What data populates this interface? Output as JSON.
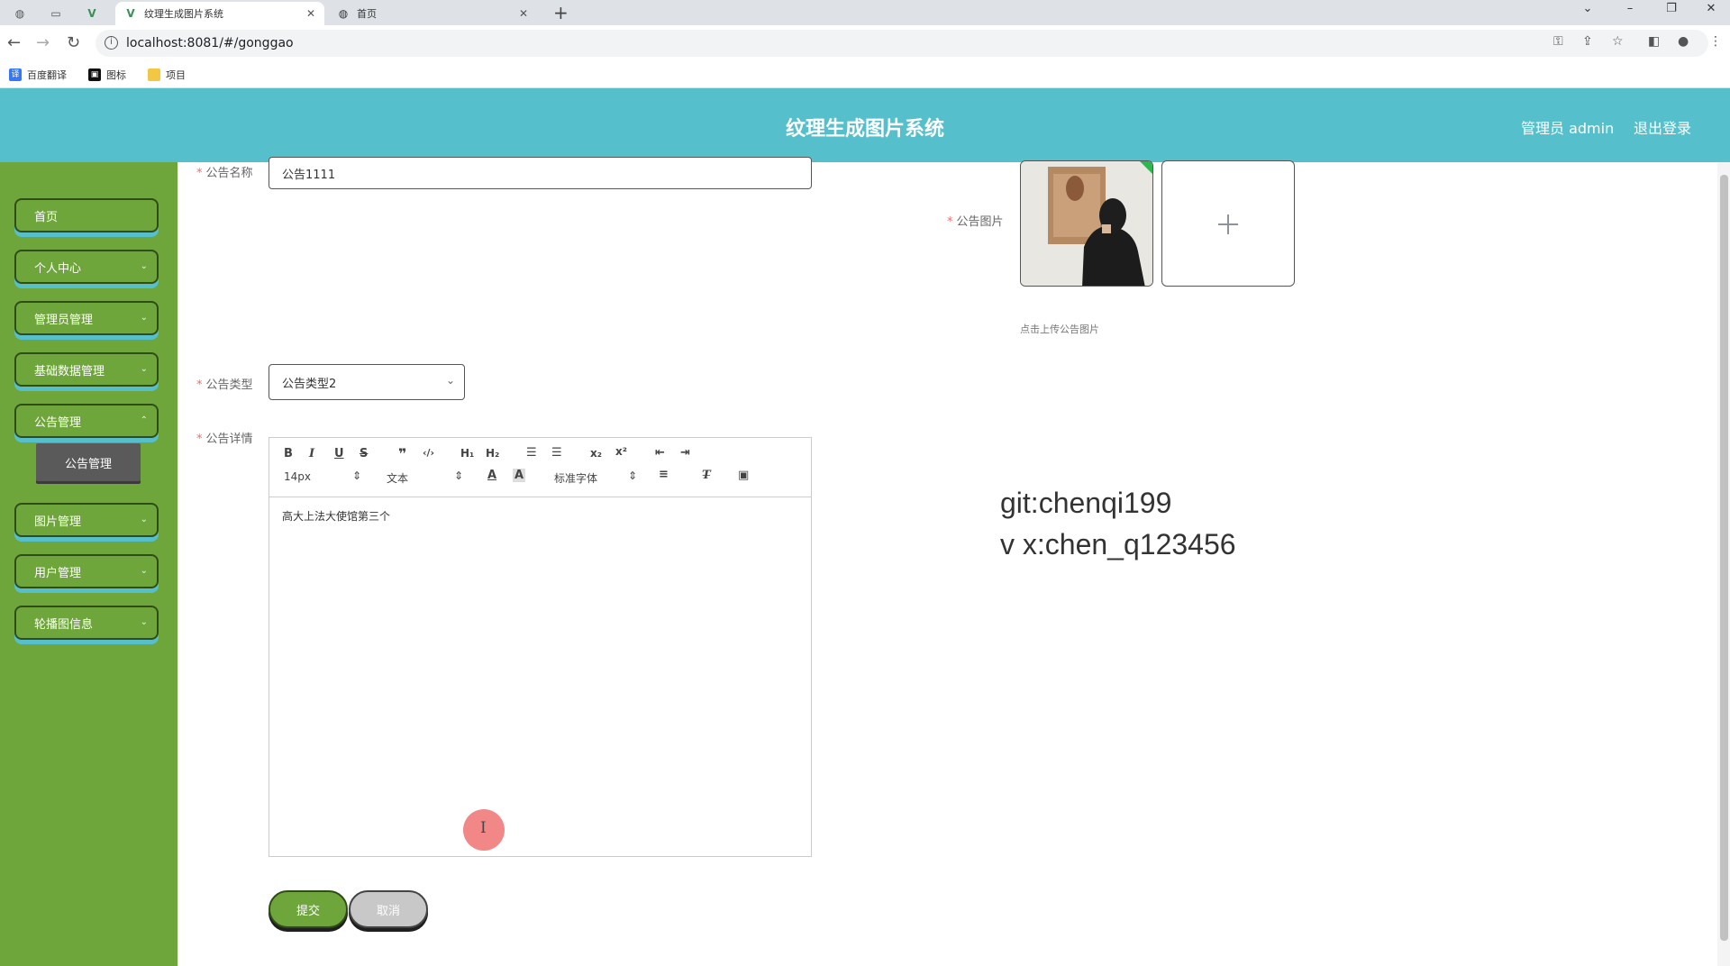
{
  "browser": {
    "tabs": [
      {
        "title": "纹理生成图片系统",
        "active": true
      },
      {
        "title": "首页",
        "active": false
      }
    ],
    "new_tab": "+",
    "url": "localhost:8081/#/gonggao",
    "bookmarks": [
      "百度翻译",
      "图标",
      "项目"
    ]
  },
  "header": {
    "title": "纹理生成图片系统",
    "user_label": "管理员 admin",
    "logout_label": "退出登录",
    "bg_color": "#55bfcc"
  },
  "sidebar": {
    "bg_color": "#6fa63c",
    "items": [
      {
        "label": "首页",
        "has_children": false
      },
      {
        "label": "个人中心",
        "has_children": true
      },
      {
        "label": "管理员管理",
        "has_children": true
      },
      {
        "label": "基础数据管理",
        "has_children": true
      },
      {
        "label": "公告管理",
        "has_children": true
      },
      {
        "label": "图片管理",
        "has_children": true
      },
      {
        "label": "用户管理",
        "has_children": true
      },
      {
        "label": "轮播图信息",
        "has_children": true
      }
    ],
    "active_subitem": "公告管理"
  },
  "form": {
    "name_label": "公告名称",
    "name_value": "公告1111",
    "image_label": "公告图片",
    "image_tip": "点击上传公告图片",
    "type_label": "公告类型",
    "type_value": "公告类型2",
    "detail_label": "公告详情",
    "editor": {
      "font_size": "14px",
      "block_format": "文本",
      "font_family": "标准字体",
      "content": "高大上法大使馆第三个"
    },
    "submit_label": "提交",
    "cancel_label": "取消"
  },
  "watermark": {
    "line1": "git:chenqi199",
    "line2": "v x:chen_q123456"
  }
}
